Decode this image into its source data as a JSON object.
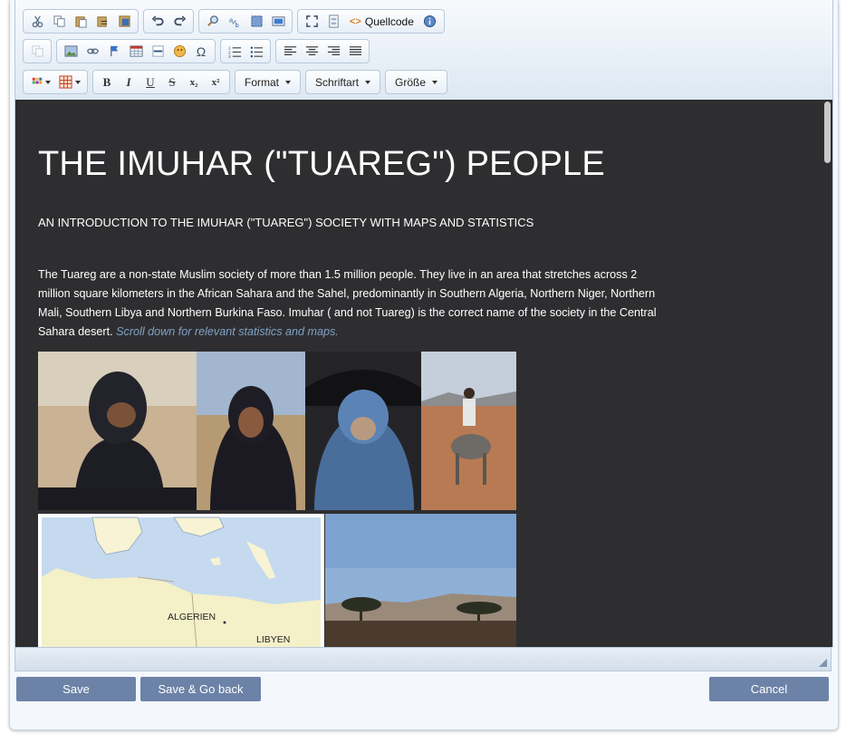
{
  "toolbar": {
    "row1": {
      "source_label": "Quellcode",
      "icons": [
        "cut-icon",
        "copy-icon",
        "paste-icon",
        "paste-text-icon",
        "paste-word-icon",
        "undo-icon",
        "redo-icon",
        "find-icon",
        "replace-icon",
        "select-all-icon",
        "spellcheck-icon",
        "maximize-icon",
        "show-blocks-icon",
        "source-icon",
        "about-icon"
      ]
    },
    "row2": {
      "icons": [
        "paste-disabled-icon",
        "image-icon",
        "link-icon",
        "anchor-icon",
        "table-icon",
        "horizontal-rule-icon",
        "smiley-icon",
        "special-char-icon",
        "numbered-list-icon",
        "bulleted-list-icon",
        "align-left-icon",
        "align-center-icon",
        "align-right-icon",
        "justify-icon"
      ],
      "special_char": "Ω"
    },
    "row3": {
      "bold": "B",
      "italic": "I",
      "underline": "U",
      "strike": "S",
      "subscript": "x₂",
      "superscript": "x²",
      "format_label": "Format",
      "font_label": "Schriftart",
      "size_label": "Größe"
    }
  },
  "content": {
    "title": "THE IMUHAR (\"TUAREG\") PEOPLE",
    "subtitle": "AN INTRODUCTION TO THE IMUHAR (\"TUAREG\") SOCIETY WITH MAPS AND STATISTICS",
    "paragraph": "The Tuareg are a non-state Muslim society of more than 1.5 million people. They live in an area that stretches across 2 million square kilometers in the African Sahara and the Sahel, predominantly in Southern Algeria, Northern Niger, Northern Mali, Southern Libya and Northern Burkina Faso. Imuhar ( and not Tuareg) is the correct name of the society in the Central Sahara desert.",
    "paragraph_link": "Scroll down for relevant statistics and maps.",
    "map_labels": {
      "algeria": "ALGERIEN",
      "libya": "LIBYEN"
    }
  },
  "actions": {
    "save": "Save",
    "save_back": "Save & Go back",
    "cancel": "Cancel"
  },
  "colors": {
    "editor_bg": "#2e2e30",
    "button_bg": "#6c82a7",
    "link": "#7fa2c8"
  }
}
